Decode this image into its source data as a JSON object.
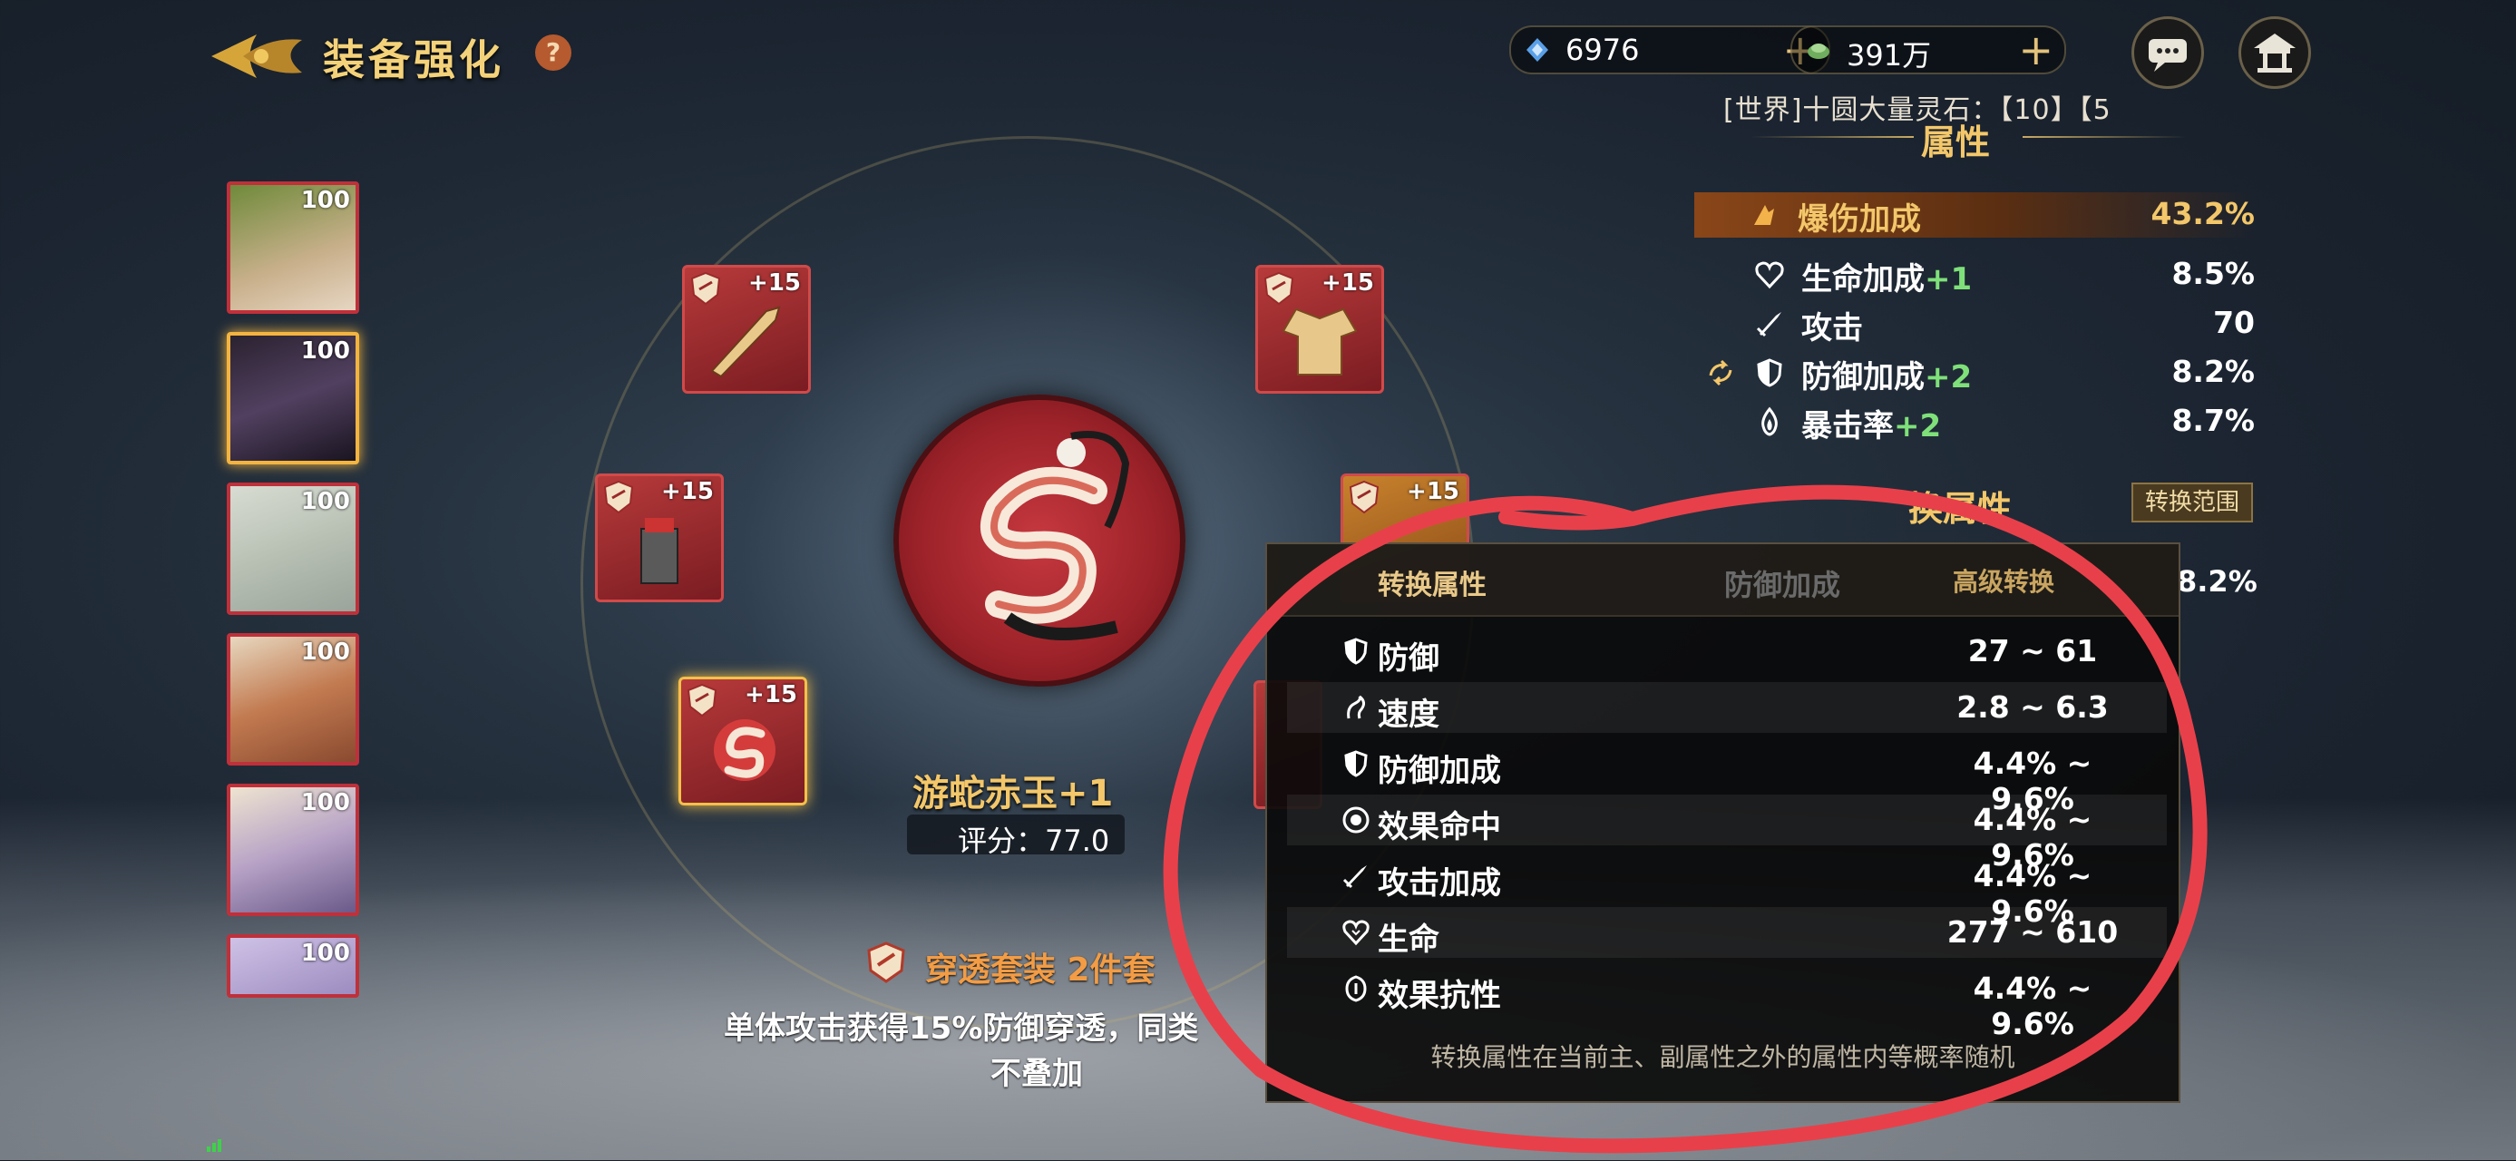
{
  "header": {
    "title": "装备强化",
    "help": "?",
    "currency_spirit": "6976",
    "currency_jade": "391万",
    "world_message": "[世界]十圆大量灵石：【10】【5"
  },
  "portraits": [
    {
      "level": "100"
    },
    {
      "level": "100"
    },
    {
      "level": "100"
    },
    {
      "level": "100"
    },
    {
      "level": "100"
    },
    {
      "level": "100"
    }
  ],
  "slots": [
    {
      "level": "+15"
    },
    {
      "level": "+15"
    },
    {
      "level": "+15"
    },
    {
      "level": "+15"
    },
    {
      "level": "+15"
    }
  ],
  "item": {
    "name": "游蛇赤玉+1",
    "score": "评分：77.0",
    "set_name": "穿透套装 2件套",
    "set_desc_line1": "单体攻击获得15%防御穿透，同类",
    "set_desc_line2": "不叠加"
  },
  "attributes": {
    "title": "属性",
    "main": {
      "label": "爆伤加成",
      "value": "43.2%"
    },
    "rows": [
      {
        "label": "生命加成",
        "plus": "+1",
        "value": "8.5%"
      },
      {
        "label": "攻击",
        "plus": "",
        "value": "70"
      },
      {
        "label": "防御加成",
        "plus": "+2",
        "value": "8.2%"
      },
      {
        "label": "暴击率",
        "plus": "+2",
        "value": "8.7%"
      }
    ],
    "convert_title": "换属性",
    "convert_range": "转换范围",
    "convert_value": "8.2%"
  },
  "popup": {
    "title": "转换属性",
    "mid_label": "防御加成",
    "right_label": "高级转换",
    "rows": [
      {
        "label": "防御",
        "range": "27 ~ 61",
        "icon": "shield-icon"
      },
      {
        "label": "速度",
        "range": "2.8 ~ 6.3",
        "icon": "speed-icon"
      },
      {
        "label": "防御加成",
        "range": "4.4% ~ 9.6%",
        "icon": "shield-icon"
      },
      {
        "label": "效果命中",
        "range": "4.4% ~ 9.6%",
        "icon": "target-icon"
      },
      {
        "label": "攻击加成",
        "range": "4.4% ~ 9.6%",
        "icon": "sword-icon"
      },
      {
        "label": "生命",
        "range": "277 ~ 610",
        "icon": "heart-icon"
      },
      {
        "label": "效果抗性",
        "range": "4.4% ~ 9.6%",
        "icon": "resist-icon"
      }
    ],
    "footer": "转换属性在当前主、副属性之外的属性内等概率随机"
  },
  "colors": {
    "accent_gold": "#f3c76a",
    "slot_red": "#b73a3a",
    "annotation_red": "#e8404a",
    "plus_green": "#7fe07a"
  }
}
